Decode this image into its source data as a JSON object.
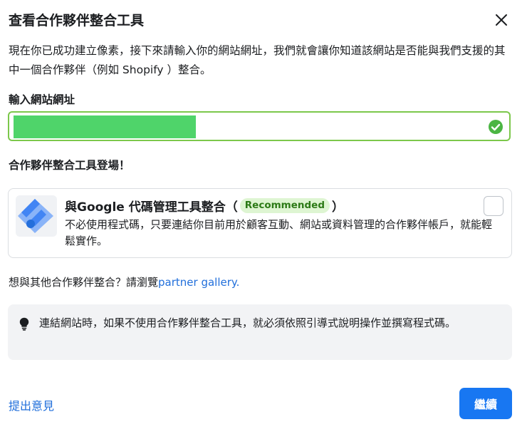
{
  "dialog": {
    "title": "查看合作夥伴整合工具",
    "close_icon": "close-icon"
  },
  "intro": {
    "text": "現在你已成功建立像素，接下來請輸入你的網站網址，我們就會讓你知道該網站是否能與我們支援的其中一個合作夥伴（例如 Shopify ）整合。"
  },
  "url": {
    "label": "輸入網站網址",
    "value": "",
    "valid_icon": "check-circle-icon",
    "highlight_color": "#4fd46a",
    "border_color": "#7cc84b"
  },
  "partners": {
    "section_title": "合作夥伴整合工具登場！",
    "card": {
      "logo_icon": "google-tag-manager-icon",
      "title_prefix": "與Google 代碼管理工具整合（",
      "badge": "Recommended",
      "title_suffix": "）",
      "description": "不必使用程式碼，只要連結你目前用於顧客互動、網站或資料管理的合作夥伴帳戶，就能輕鬆實作。",
      "checked": false
    },
    "more_text": "想與其他合作夥伴整合？請瀏覽",
    "more_link": "partner gallery."
  },
  "tip": {
    "icon": "lightbulb-icon",
    "text": "連結網站時，如果不使用合作夥伴整合工具，就必須依照引導式說明操作並撰寫程式碼。"
  },
  "footer": {
    "feedback_label": "提出意見",
    "continue_label": "繼續",
    "primary_color": "#1877f2",
    "link_color": "#216fdb"
  }
}
